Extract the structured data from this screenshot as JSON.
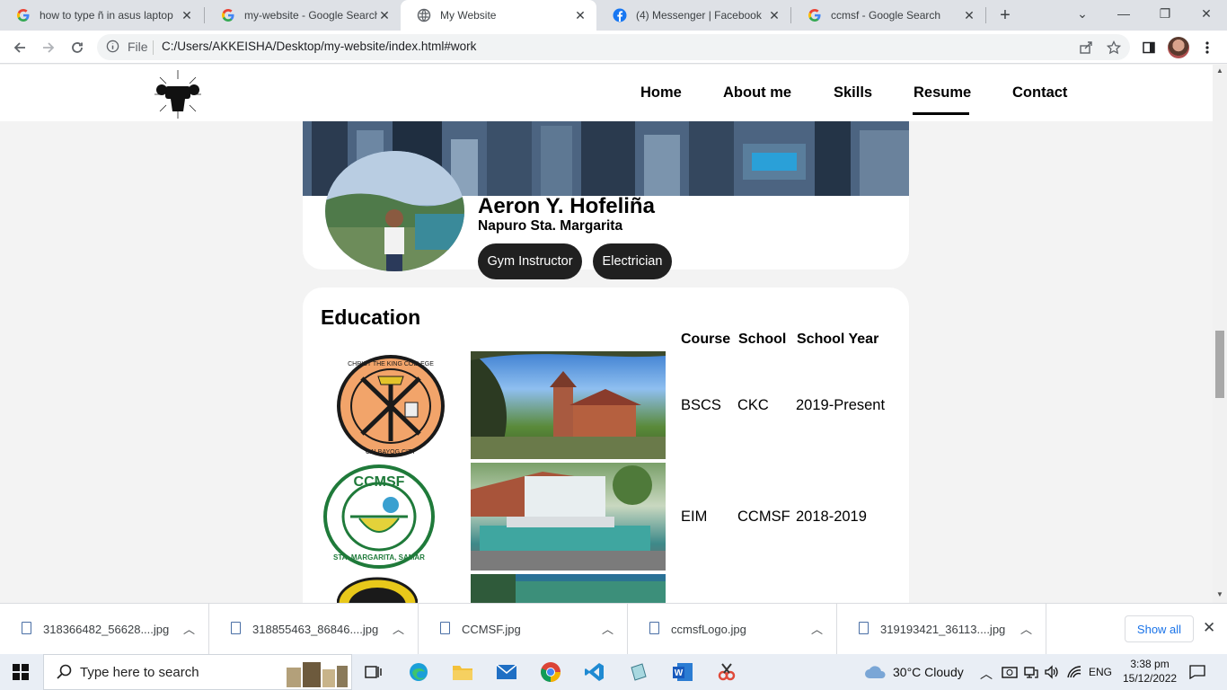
{
  "browser": {
    "tabs": [
      {
        "title": "how to type ñ in asus laptop",
        "favicon": "google-icon",
        "active": false
      },
      {
        "title": "my-website - Google Search",
        "favicon": "google-icon",
        "active": false
      },
      {
        "title": "My Website",
        "favicon": "globe-icon",
        "active": true
      },
      {
        "title": "(4) Messenger | Facebook",
        "favicon": "facebook-icon",
        "active": false
      },
      {
        "title": "ccmsf - Google Search",
        "favicon": "google-icon",
        "active": false
      }
    ],
    "omnibox": {
      "scheme_label": "File",
      "url": "C:/Users/AKKEISHA/Desktop/my-website/index.html#work"
    }
  },
  "site": {
    "nav": [
      {
        "label": "Home",
        "active": false
      },
      {
        "label": "About me",
        "active": false
      },
      {
        "label": "Skills",
        "active": false
      },
      {
        "label": "Resume",
        "active": true
      },
      {
        "label": "Contact",
        "active": false
      }
    ],
    "profile": {
      "name": "Aeron Y. Hofeliña",
      "address": "Napuro Sta. Margarita",
      "tags": [
        "Gym Instructor",
        "Electrician"
      ]
    },
    "education": {
      "title": "Education",
      "columns": [
        "Course",
        "School",
        "School Year"
      ],
      "rows": [
        {
          "course": "BSCS",
          "school": "CKC",
          "year": "2019-Present",
          "logo_text": "CHRIST THE KING COLLEGE",
          "logo_sub": "CALBAYOG CITY"
        },
        {
          "course": "EIM",
          "school": "CCMSF",
          "year": "2018-2019",
          "logo_text": "CCMSF",
          "logo_sub": "STA. MARGARITA, SAMAR"
        }
      ]
    }
  },
  "downloads": {
    "items": [
      "318366482_56628....jpg",
      "318855463_86846....jpg",
      "CCMSF.jpg",
      "ccmsfLogo.jpg",
      "319193421_36113....jpg"
    ],
    "show_all": "Show all"
  },
  "taskbar": {
    "search_placeholder": "Type here to search",
    "weather": "30°C  Cloudy",
    "language": "ENG",
    "time": "3:38 pm",
    "date": "15/12/2022"
  },
  "colors": {
    "accent_blue": "#1a73e8",
    "pill_bg": "#202020",
    "page_bg": "#f3f3f3"
  }
}
